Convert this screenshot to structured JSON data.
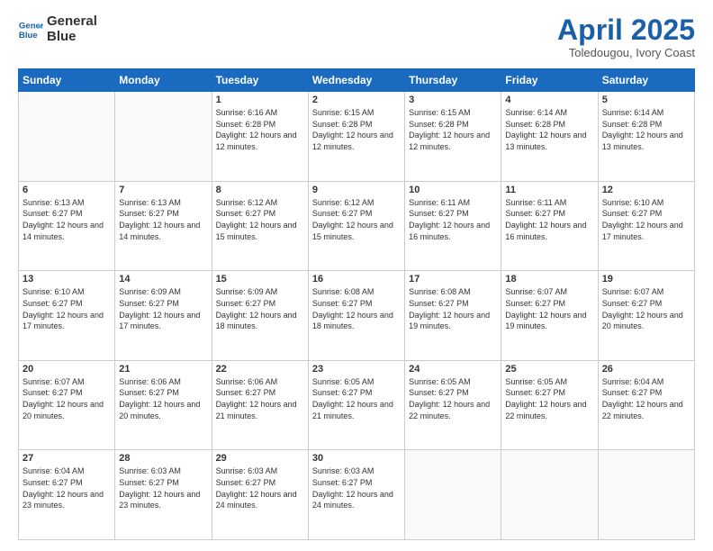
{
  "logo": {
    "line1": "General",
    "line2": "Blue"
  },
  "title": "April 2025",
  "location": "Toledougou, Ivory Coast",
  "days_of_week": [
    "Sunday",
    "Monday",
    "Tuesday",
    "Wednesday",
    "Thursday",
    "Friday",
    "Saturday"
  ],
  "weeks": [
    [
      {
        "day": "",
        "info": ""
      },
      {
        "day": "",
        "info": ""
      },
      {
        "day": "1",
        "info": "Sunrise: 6:16 AM\nSunset: 6:28 PM\nDaylight: 12 hours and 12 minutes."
      },
      {
        "day": "2",
        "info": "Sunrise: 6:15 AM\nSunset: 6:28 PM\nDaylight: 12 hours and 12 minutes."
      },
      {
        "day": "3",
        "info": "Sunrise: 6:15 AM\nSunset: 6:28 PM\nDaylight: 12 hours and 12 minutes."
      },
      {
        "day": "4",
        "info": "Sunrise: 6:14 AM\nSunset: 6:28 PM\nDaylight: 12 hours and 13 minutes."
      },
      {
        "day": "5",
        "info": "Sunrise: 6:14 AM\nSunset: 6:28 PM\nDaylight: 12 hours and 13 minutes."
      }
    ],
    [
      {
        "day": "6",
        "info": "Sunrise: 6:13 AM\nSunset: 6:27 PM\nDaylight: 12 hours and 14 minutes."
      },
      {
        "day": "7",
        "info": "Sunrise: 6:13 AM\nSunset: 6:27 PM\nDaylight: 12 hours and 14 minutes."
      },
      {
        "day": "8",
        "info": "Sunrise: 6:12 AM\nSunset: 6:27 PM\nDaylight: 12 hours and 15 minutes."
      },
      {
        "day": "9",
        "info": "Sunrise: 6:12 AM\nSunset: 6:27 PM\nDaylight: 12 hours and 15 minutes."
      },
      {
        "day": "10",
        "info": "Sunrise: 6:11 AM\nSunset: 6:27 PM\nDaylight: 12 hours and 16 minutes."
      },
      {
        "day": "11",
        "info": "Sunrise: 6:11 AM\nSunset: 6:27 PM\nDaylight: 12 hours and 16 minutes."
      },
      {
        "day": "12",
        "info": "Sunrise: 6:10 AM\nSunset: 6:27 PM\nDaylight: 12 hours and 17 minutes."
      }
    ],
    [
      {
        "day": "13",
        "info": "Sunrise: 6:10 AM\nSunset: 6:27 PM\nDaylight: 12 hours and 17 minutes."
      },
      {
        "day": "14",
        "info": "Sunrise: 6:09 AM\nSunset: 6:27 PM\nDaylight: 12 hours and 17 minutes."
      },
      {
        "day": "15",
        "info": "Sunrise: 6:09 AM\nSunset: 6:27 PM\nDaylight: 12 hours and 18 minutes."
      },
      {
        "day": "16",
        "info": "Sunrise: 6:08 AM\nSunset: 6:27 PM\nDaylight: 12 hours and 18 minutes."
      },
      {
        "day": "17",
        "info": "Sunrise: 6:08 AM\nSunset: 6:27 PM\nDaylight: 12 hours and 19 minutes."
      },
      {
        "day": "18",
        "info": "Sunrise: 6:07 AM\nSunset: 6:27 PM\nDaylight: 12 hours and 19 minutes."
      },
      {
        "day": "19",
        "info": "Sunrise: 6:07 AM\nSunset: 6:27 PM\nDaylight: 12 hours and 20 minutes."
      }
    ],
    [
      {
        "day": "20",
        "info": "Sunrise: 6:07 AM\nSunset: 6:27 PM\nDaylight: 12 hours and 20 minutes."
      },
      {
        "day": "21",
        "info": "Sunrise: 6:06 AM\nSunset: 6:27 PM\nDaylight: 12 hours and 20 minutes."
      },
      {
        "day": "22",
        "info": "Sunrise: 6:06 AM\nSunset: 6:27 PM\nDaylight: 12 hours and 21 minutes."
      },
      {
        "day": "23",
        "info": "Sunrise: 6:05 AM\nSunset: 6:27 PM\nDaylight: 12 hours and 21 minutes."
      },
      {
        "day": "24",
        "info": "Sunrise: 6:05 AM\nSunset: 6:27 PM\nDaylight: 12 hours and 22 minutes."
      },
      {
        "day": "25",
        "info": "Sunrise: 6:05 AM\nSunset: 6:27 PM\nDaylight: 12 hours and 22 minutes."
      },
      {
        "day": "26",
        "info": "Sunrise: 6:04 AM\nSunset: 6:27 PM\nDaylight: 12 hours and 22 minutes."
      }
    ],
    [
      {
        "day": "27",
        "info": "Sunrise: 6:04 AM\nSunset: 6:27 PM\nDaylight: 12 hours and 23 minutes."
      },
      {
        "day": "28",
        "info": "Sunrise: 6:03 AM\nSunset: 6:27 PM\nDaylight: 12 hours and 23 minutes."
      },
      {
        "day": "29",
        "info": "Sunrise: 6:03 AM\nSunset: 6:27 PM\nDaylight: 12 hours and 24 minutes."
      },
      {
        "day": "30",
        "info": "Sunrise: 6:03 AM\nSunset: 6:27 PM\nDaylight: 12 hours and 24 minutes."
      },
      {
        "day": "",
        "info": ""
      },
      {
        "day": "",
        "info": ""
      },
      {
        "day": "",
        "info": ""
      }
    ]
  ]
}
